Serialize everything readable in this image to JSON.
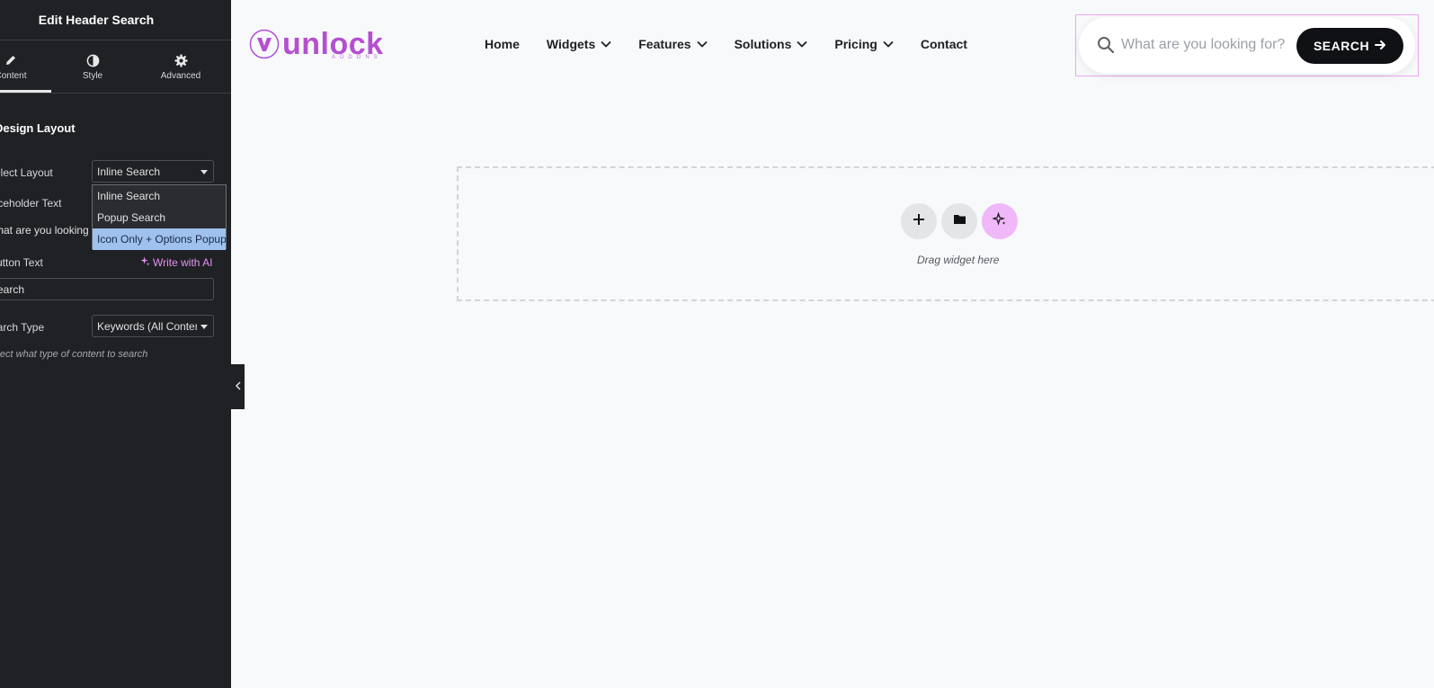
{
  "sidebar": {
    "title": "Edit Header Search",
    "tabs": [
      {
        "label": "Content",
        "icon": "pencil-icon"
      },
      {
        "label": "Style",
        "icon": "half-circle-icon"
      },
      {
        "label": "Advanced",
        "icon": "gear-icon"
      }
    ],
    "section_title": "Design Layout",
    "fields": {
      "layout_label": "Select Layout",
      "layout_value": "Inline Search",
      "placeholder_label": "Placeholder Text",
      "placeholder_value": "What are you looking for?",
      "button_text_label": "Button Text",
      "write_ai": "Write with AI",
      "button_text_value": "Search",
      "search_type_label": "Search Type",
      "search_type_value": "Keywords (All Content)",
      "search_type_hint": "Select what type of content to search"
    },
    "layout_options": [
      "Inline Search",
      "Popup Search",
      "Icon Only + Options Popup"
    ],
    "selected_option_index": 2
  },
  "header": {
    "logo_text": "unlock",
    "logo_sub": "ADDONS",
    "nav": [
      {
        "label": "Home",
        "has_dropdown": false
      },
      {
        "label": "Widgets",
        "has_dropdown": true
      },
      {
        "label": "Features",
        "has_dropdown": true
      },
      {
        "label": "Solutions",
        "has_dropdown": true
      },
      {
        "label": "Pricing",
        "has_dropdown": true
      },
      {
        "label": "Contact",
        "has_dropdown": false
      }
    ],
    "search": {
      "placeholder": "What are you looking for?",
      "button_label": "SEARCH"
    }
  },
  "canvas": {
    "drop_label": "Drag widget here"
  },
  "colors": {
    "sidebar_bg": "#1f2124",
    "accent_pink": "#e78ff7",
    "logo_purple": "#b44fd2",
    "selected_option": "#9fc1ee",
    "search_button": "#101114"
  }
}
